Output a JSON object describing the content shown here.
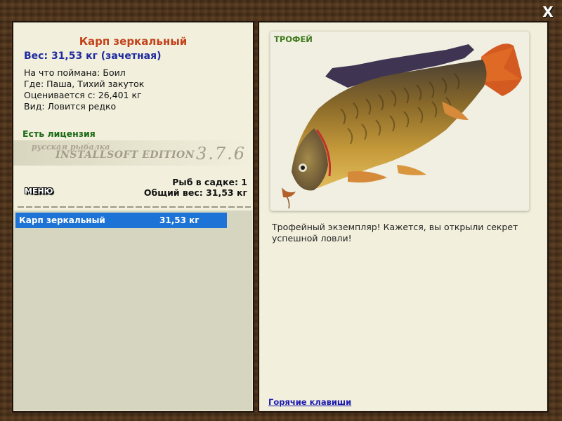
{
  "window": {
    "close_label": "X"
  },
  "fish": {
    "name": "Карп зеркальный",
    "weight_line": "Вес: 31,53 кг (зачетная)",
    "details": [
      "На что поймана: Боил",
      "Где: Паша, Тихий закуток",
      "Оценивается с: 26,401 кг",
      "Вид: Ловится редко"
    ]
  },
  "license": "Есть лицензия",
  "watermark": {
    "line1": "русская рыбалка",
    "line2": "INSTALLSOFT EDITION",
    "version": "3.7.6"
  },
  "keepnet": {
    "count_line": "Рыб в садке: 1",
    "total_line": "Общий вес: 31,53 кг",
    "items": [
      {
        "name": "Карп зеркальный",
        "weight": "31,53 кг"
      }
    ]
  },
  "menu_label": "МЕНЮ",
  "trophy": {
    "badge": "ТРОФЕЙ",
    "description": "Трофейный экземпляр! Кажется, вы открыли секрет успешной ловли!",
    "image_icon": "mirror-carp-icon"
  },
  "hotkeys_link": "Горячие клавиши",
  "colors": {
    "title": "#c2411a",
    "weight": "#1e2aa0",
    "license": "#1a6a16",
    "selection": "#1e73d6",
    "trophy_badge": "#3f7a1c",
    "link": "#1a1ab0"
  }
}
